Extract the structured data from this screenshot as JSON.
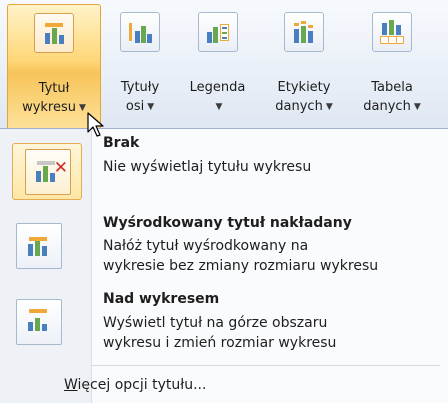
{
  "ribbon": {
    "buttons": [
      {
        "line1": "Tytuł",
        "line2": "wykresu",
        "dropdown": true,
        "active": true,
        "icon": "chart-title-icon"
      },
      {
        "line1": "Tytuły",
        "line2": "osi",
        "dropdown": true,
        "active": false,
        "icon": "axis-titles-icon"
      },
      {
        "line1": "Legenda",
        "line2": "",
        "dropdown": true,
        "active": false,
        "icon": "legend-icon"
      },
      {
        "line1": "Etykiety",
        "line2": "danych",
        "dropdown": true,
        "active": false,
        "icon": "data-labels-icon"
      },
      {
        "line1": "Tabela",
        "line2": "danych",
        "dropdown": true,
        "active": false,
        "icon": "data-table-icon"
      }
    ]
  },
  "menu": {
    "items": [
      {
        "title": "Brak",
        "desc": [
          "Nie wyświetlaj tytułu wykresu"
        ],
        "icon": "no-title-icon",
        "selected": true
      },
      {
        "title": "Wyśrodkowany tytuł nakładany",
        "desc": [
          "Nałóż tytuł wyśrodkowany na",
          "wykresie bez zmiany rozmiaru wykresu"
        ],
        "icon": "centered-overlay-title-icon",
        "selected": false
      },
      {
        "title": "Nad wykresem",
        "desc": [
          "Wyświetl tytuł na górze obszaru",
          "wykresu i zmień rozmiar wykresu"
        ],
        "icon": "above-chart-title-icon",
        "selected": false
      }
    ],
    "more_prefix": "W",
    "more_rest": "ięcej opcji tytułu..."
  },
  "colors": {
    "accent_orange": "#f0a838",
    "bar_blue": "#4a7fbf",
    "bar_green": "#6aa84f",
    "remove_red": "#d02b2b"
  }
}
